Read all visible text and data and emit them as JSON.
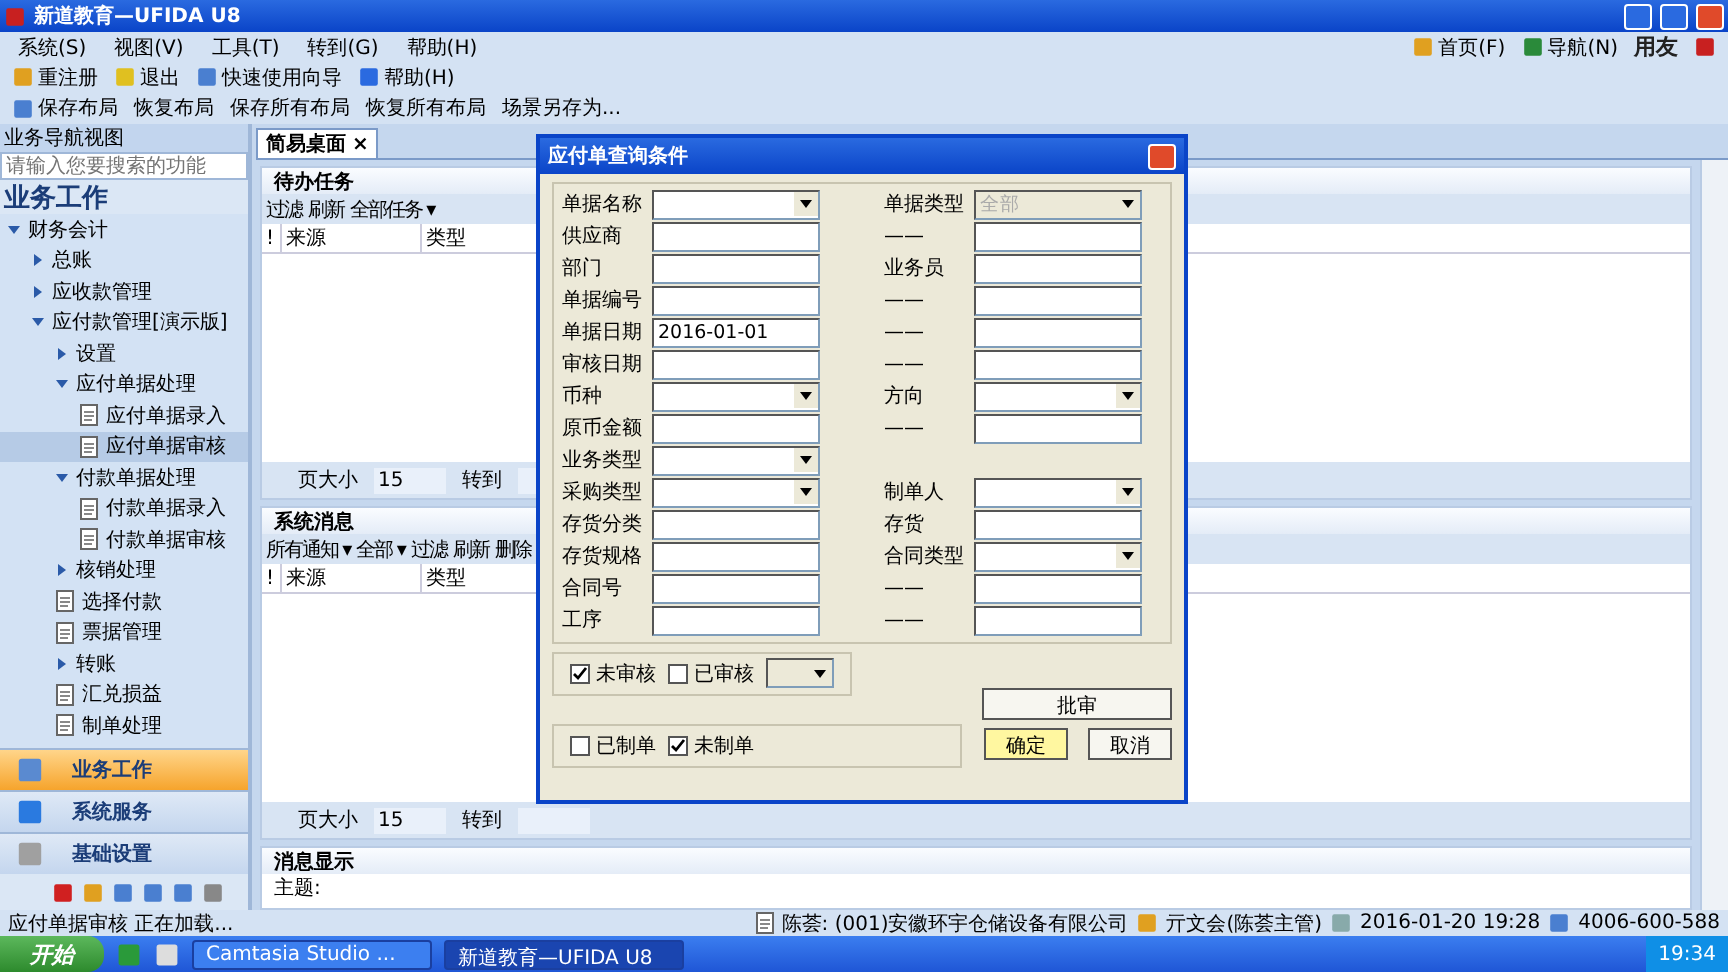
{
  "window": {
    "title": "新道教育—UFIDA U8"
  },
  "menu": [
    "系统(S)",
    "视图(V)",
    "工具(T)",
    "转到(G)",
    "帮助(H)"
  ],
  "top_links": [
    "首页(F)",
    "导航(N)"
  ],
  "brand": "用友",
  "toolbar": [
    "重注册",
    "退出",
    "快速使用向导",
    "帮助(H)"
  ],
  "layout_bar": [
    "保存布局",
    "恢复布局",
    "保存所有布局",
    "恢复所有布局",
    "场景另存为..."
  ],
  "sidebar": {
    "title": "业务导航视图",
    "search": {
      "placeholder": "请输入您要搜索的功能"
    },
    "heading": "业务工作",
    "tree": [
      {
        "label": "财务会计",
        "expanded": true,
        "selected": false,
        "children": [
          {
            "label": "总账",
            "expanded": false,
            "selected": false
          },
          {
            "label": "应收款管理",
            "expanded": false,
            "selected": false
          },
          {
            "label": "应付款管理[演示版]",
            "expanded": true,
            "selected": false,
            "children": [
              {
                "label": "设置",
                "expanded": false,
                "selected": false
              },
              {
                "label": "应付单据处理",
                "expanded": true,
                "selected": false,
                "children": [
                  {
                    "label": "应付单据录入",
                    "selected": false
                  },
                  {
                    "label": "应付单据审核",
                    "selected": true
                  }
                ]
              },
              {
                "label": "付款单据处理",
                "expanded": true,
                "selected": false,
                "children": [
                  {
                    "label": "付款单据录入",
                    "selected": false
                  },
                  {
                    "label": "付款单据审核",
                    "selected": false
                  }
                ]
              },
              {
                "label": "核销处理",
                "expanded": false,
                "selected": false
              },
              {
                "label": "选择付款",
                "selected": false
              },
              {
                "label": "票据管理",
                "selected": false
              },
              {
                "label": "转账",
                "expanded": false,
                "selected": false
              },
              {
                "label": "汇兑损益",
                "selected": false
              },
              {
                "label": "制单处理",
                "selected": false
              }
            ]
          }
        ]
      }
    ],
    "nav": [
      {
        "label": "业务工作",
        "selected": true
      },
      {
        "label": "系统服务",
        "selected": false
      },
      {
        "label": "基础设置",
        "selected": false
      }
    ]
  },
  "tab": {
    "label": "简易桌面",
    "close": "×"
  },
  "panels": [
    {
      "title": "待办任务",
      "kind": "list",
      "actions": [
        "过滤",
        "刷新",
        "全部任务 ▾"
      ],
      "columns": [
        "!",
        "来源",
        "类型"
      ],
      "pager": {
        "size_label": "页大小",
        "size": "15",
        "goto": "转到"
      }
    },
    {
      "title": "系统消息",
      "kind": "list",
      "actions": [
        "所有通知 ▾",
        "全部 ▾",
        "过滤",
        "刷新",
        "删除"
      ],
      "columns": [
        "!",
        "来源",
        "类型"
      ],
      "pager": {
        "size_label": "页大小",
        "size": "15",
        "goto": "转到"
      }
    },
    {
      "title": "消息显示",
      "kind": "message",
      "subject": "主题:"
    }
  ],
  "dialog": {
    "title": "应付单查询条件",
    "rows": [
      {
        "left": {
          "label": "单据名称",
          "kind": "select"
        },
        "right": {
          "label": "单据类型",
          "kind": "select",
          "value": "全部",
          "disabled": true
        }
      },
      {
        "left": {
          "label": "供应商",
          "kind": "input"
        },
        "right": {
          "label": "——",
          "kind": "input"
        }
      },
      {
        "left": {
          "label": "部门",
          "kind": "input"
        },
        "right": {
          "label": "业务员",
          "kind": "input"
        }
      },
      {
        "left": {
          "label": "单据编号",
          "kind": "input"
        },
        "right": {
          "label": "——",
          "kind": "input"
        }
      },
      {
        "left": {
          "label": "单据日期",
          "kind": "input",
          "value": "2016-01-01"
        },
        "right": {
          "label": "——",
          "kind": "input"
        }
      },
      {
        "left": {
          "label": "审核日期",
          "kind": "input"
        },
        "right": {
          "label": "——",
          "kind": "input"
        }
      },
      {
        "left": {
          "label": "币种",
          "kind": "select"
        },
        "right": {
          "label": "方向",
          "kind": "select"
        }
      },
      {
        "left": {
          "label": "原币金额",
          "kind": "input"
        },
        "right": {
          "label": "——",
          "kind": "input"
        }
      },
      {
        "left": {
          "label": "业务类型",
          "kind": "select"
        }
      },
      {
        "left": {
          "label": "采购类型",
          "kind": "select"
        },
        "right": {
          "label": "制单人",
          "kind": "select"
        }
      },
      {
        "left": {
          "label": "存货分类",
          "kind": "input"
        },
        "right": {
          "label": "存货",
          "kind": "input"
        }
      },
      {
        "left": {
          "label": "存货规格",
          "kind": "input"
        },
        "right": {
          "label": "合同类型",
          "kind": "select"
        }
      },
      {
        "left": {
          "label": "合同号",
          "kind": "input"
        },
        "right": {
          "label": "——",
          "kind": "input"
        }
      },
      {
        "left": {
          "label": "工序",
          "kind": "input"
        },
        "right": {
          "label": "——",
          "kind": "input"
        }
      }
    ],
    "audit": [
      {
        "label": "未审核",
        "checked": true
      },
      {
        "label": "已审核",
        "checked": false
      }
    ],
    "voucher": [
      {
        "label": "已制单",
        "checked": false
      },
      {
        "label": "未制单",
        "checked": true
      }
    ],
    "buttons": [
      "批审",
      "确定",
      "取消"
    ]
  },
  "status_bar": {
    "left": "应付单据审核 正在加载...",
    "user": "陈荟: (001)安徽环宇仓储设备有限公司",
    "operator": "亓文会(陈荟主管)",
    "datetime": "2016-01-20 19:28",
    "phone": "4006-600-588"
  },
  "taskbar": {
    "start": "开始",
    "tasks": [
      {
        "label": "Camtasia Studio ...",
        "selected": false
      },
      {
        "label": "新道教育—UFIDA U8",
        "selected": true
      }
    ],
    "clock": "19:34"
  }
}
